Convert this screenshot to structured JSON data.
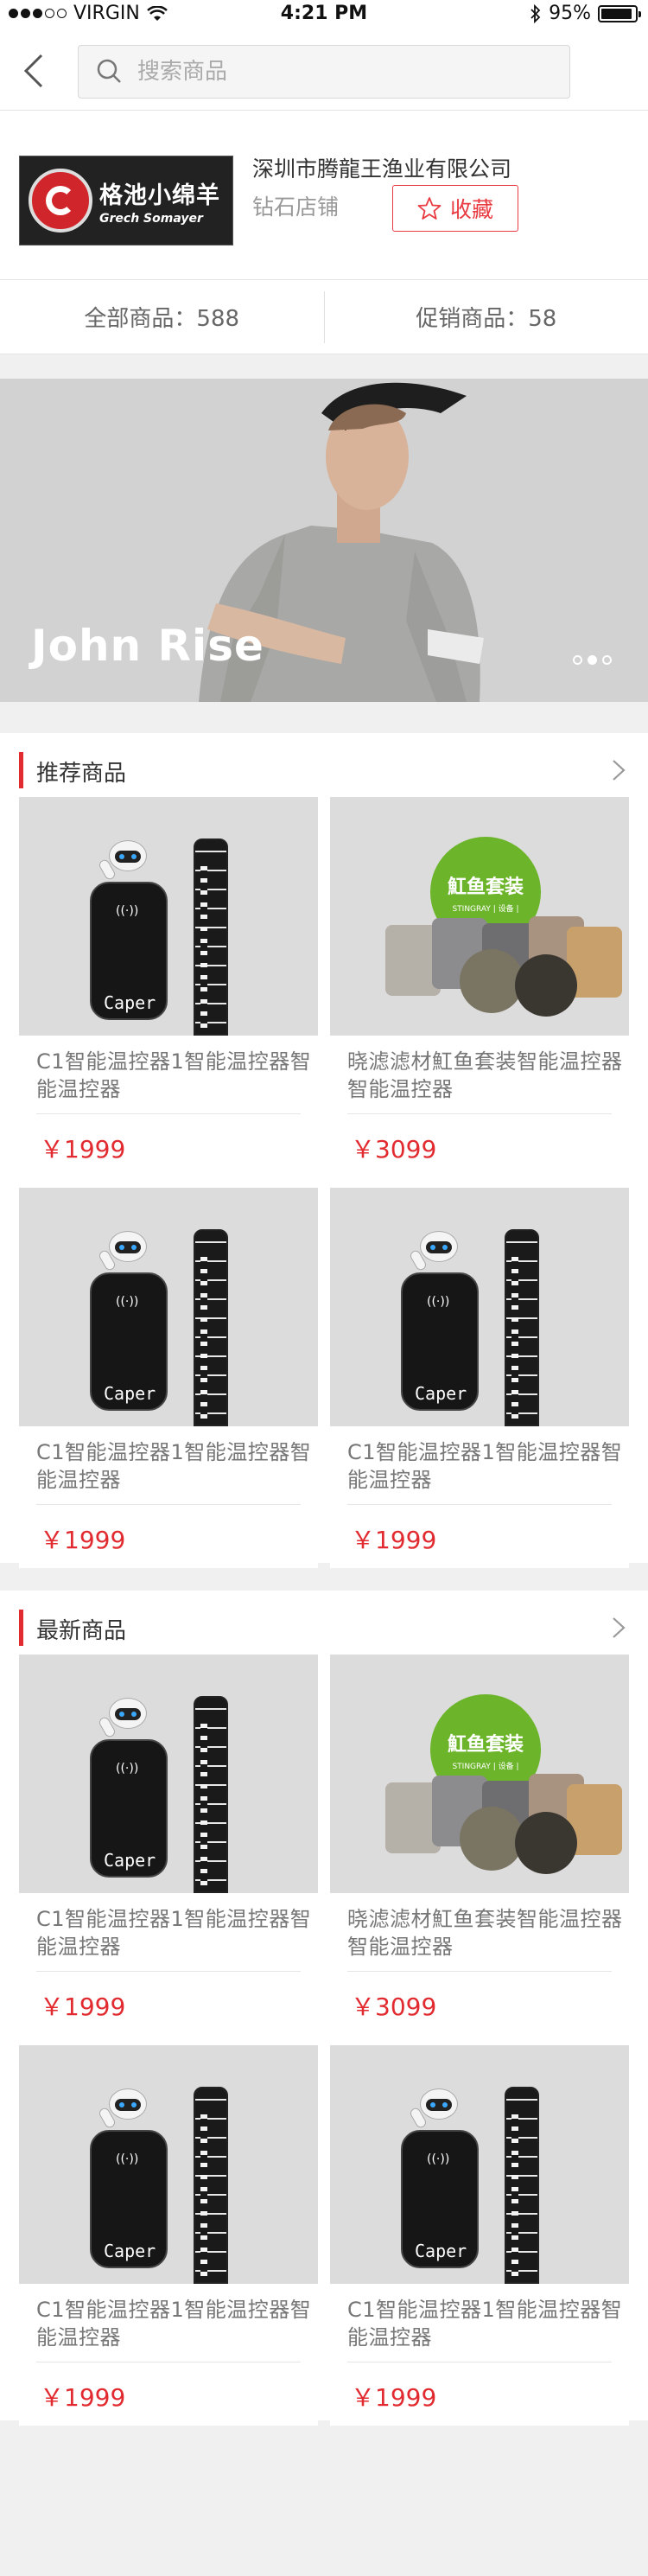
{
  "status_bar": {
    "carrier": "VIRGIN",
    "time": "4:21 PM",
    "battery": "95%",
    "battery_level": 0.95
  },
  "nav": {
    "search_placeholder": "搜索商品"
  },
  "shop": {
    "logo_cn": "格池小绵羊",
    "logo_en": "Grech Somayer",
    "name": "深圳市腾龍王渔业有限公司",
    "level": "钻石店铺",
    "favorite_label": "收藏"
  },
  "counts": {
    "all": "全部商品：588",
    "promo": "促销商品：58"
  },
  "banner": {
    "title": "John Rise",
    "slide_count": 3,
    "active_slide": 2
  },
  "sections": [
    {
      "title": "推荐商品",
      "products": [
        {
          "name": "C1智能温控器1智能温控器智能温控器",
          "price": "￥1999",
          "art": "device",
          "brand": "Caper"
        },
        {
          "name": "晓滤滤材魟鱼套装智能温控器智能温控器",
          "price": "￥3099",
          "art": "media",
          "badge": "魟鱼套装",
          "badge_sub": "STINGRAY | 设备 |"
        },
        {
          "name": "C1智能温控器1智能温控器智能温控器",
          "price": "￥1999",
          "art": "device",
          "brand": "Caper"
        },
        {
          "name": "C1智能温控器1智能温控器智能温控器",
          "price": "￥1999",
          "art": "device",
          "brand": "Caper"
        }
      ]
    },
    {
      "title": "最新商品",
      "products": [
        {
          "name": "C1智能温控器1智能温控器智能温控器",
          "price": "￥1999",
          "art": "device",
          "brand": "Caper"
        },
        {
          "name": "晓滤滤材魟鱼套装智能温控器智能温控器",
          "price": "￥3099",
          "art": "media",
          "badge": "魟鱼套装",
          "badge_sub": "STINGRAY | 设备 |"
        },
        {
          "name": "C1智能温控器1智能温控器智能温控器",
          "price": "￥1999",
          "art": "device",
          "brand": "Caper"
        },
        {
          "name": "C1智能温控器1智能温控器智能温控器",
          "price": "￥1999",
          "art": "device",
          "brand": "Caper"
        }
      ]
    }
  ],
  "colors": {
    "accent": "#e12b30",
    "badge_green": "#6cb52b",
    "background": "#f0f0f0"
  }
}
